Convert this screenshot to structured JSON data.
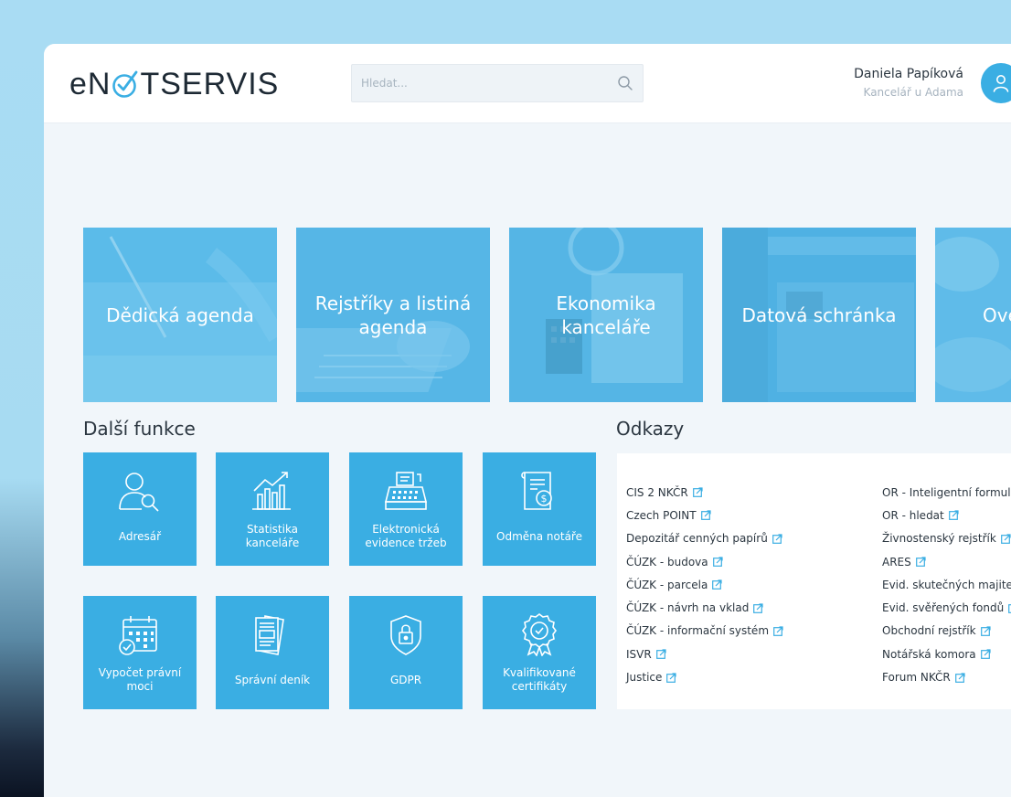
{
  "header": {
    "logo_text": {
      "before": "eN",
      "after": "TSERVIS"
    },
    "search_placeholder": "Hledat...",
    "user_name": "Daniela Papíková",
    "user_office": "Kancelář u Adama"
  },
  "main_tiles": [
    {
      "label": "Dědická agenda"
    },
    {
      "label": "Rejstříky a listiná agenda"
    },
    {
      "label": "Ekonomika kanceláře"
    },
    {
      "label": "Datová schránka"
    },
    {
      "label": "Ově"
    }
  ],
  "functions": {
    "title": "Další funkce",
    "items": [
      {
        "label": "Adresář",
        "icon": "address-book-icon"
      },
      {
        "label": "Statistika kanceláře",
        "icon": "chart-icon"
      },
      {
        "label": "Elektronická evidence tržeb",
        "icon": "cash-register-icon"
      },
      {
        "label": "Odměna notáře",
        "icon": "invoice-icon"
      },
      {
        "label": "Vypočet právní moci",
        "icon": "calendar-icon"
      },
      {
        "label": "Správní deník",
        "icon": "documents-icon"
      },
      {
        "label": "GDPR",
        "icon": "lock-shield-icon"
      },
      {
        "label": "Kvalifikované certifikáty",
        "icon": "certificate-icon"
      }
    ]
  },
  "links": {
    "title": "Odkazy",
    "left": [
      "CIS 2 NKČR",
      "Czech POINT",
      "Depozitář cenných papírů",
      "ČÚZK - budova",
      "ČÚZK - parcela",
      "ČÚZK - návrh na vklad",
      "ČÚZK - informační systém",
      "ISVR",
      "Justice"
    ],
    "right": [
      "OR - Inteligentní formulá",
      "OR - hledat",
      "Živnostenský rejstřík",
      "ARES",
      "Evid. skutečných majitel",
      "Evid. svěřených fondů",
      "Obchodní rejstřík",
      "Notářská komora",
      "Forum NKČR"
    ]
  },
  "colors": {
    "accent": "#3aaee3",
    "tile_overlay": "#4fb4e6",
    "page_bg": "#f1f6fa"
  }
}
